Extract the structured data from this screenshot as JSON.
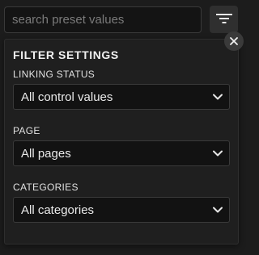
{
  "search": {
    "placeholder": "search preset values",
    "value": ""
  },
  "icons": {
    "filter": "filter-icon",
    "close": "close-icon",
    "chevron": "chevron-down-icon"
  },
  "filter_panel": {
    "title": "FILTER SETTINGS",
    "linking_status": {
      "label": "LINKING STATUS",
      "selected": "All control values"
    },
    "page": {
      "label": "PAGE",
      "selected": "All pages"
    },
    "categories": {
      "label": "CATEGORIES",
      "selected": "All categories"
    }
  },
  "colors": {
    "background": "#1c1c1c",
    "panel": "#1f1f1f",
    "control": "#121212",
    "text": "#e6e6e6"
  }
}
